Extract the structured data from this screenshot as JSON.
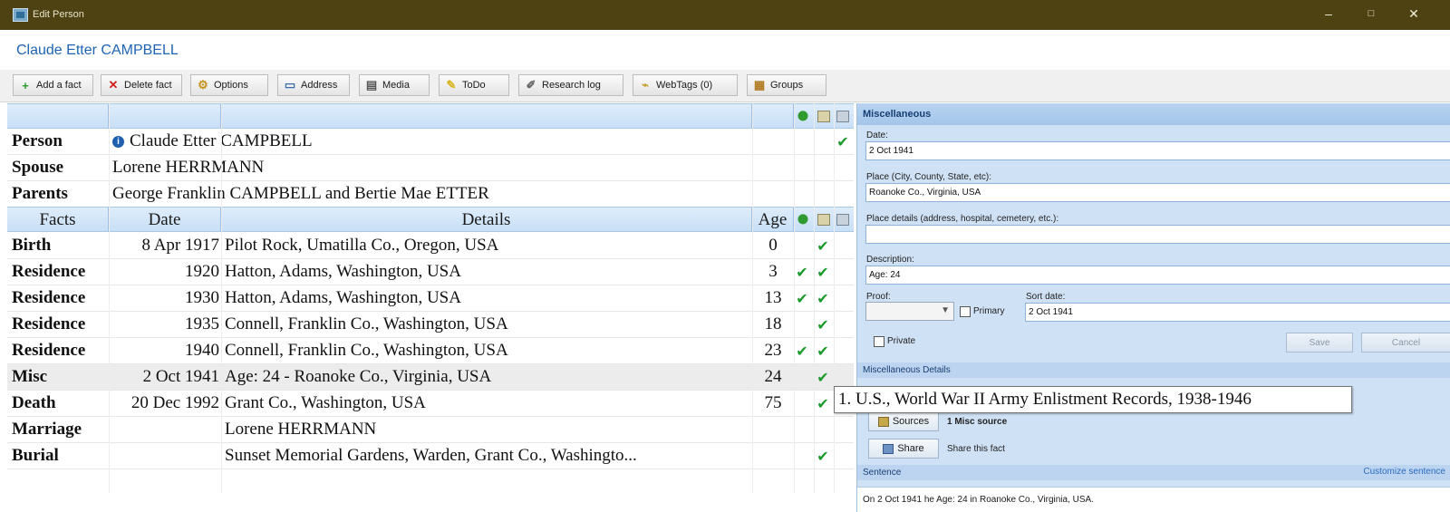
{
  "window": {
    "title": "Edit Person",
    "minimize": "–",
    "maximize": "□",
    "close": "✕"
  },
  "header": {
    "person_name": "Claude Etter CAMPBELL"
  },
  "toolbar": {
    "add_fact": "Add a fact",
    "delete_fact": "Delete fact",
    "options": "Options",
    "address": "Address",
    "media": "Media",
    "todo": "ToDo",
    "research_log": "Research log",
    "webtags": "WebTags (0)",
    "groups": "Groups"
  },
  "summary": [
    {
      "label": "Person",
      "value": "Claude Etter CAMPBELL",
      "check": "✔"
    },
    {
      "label": "Spouse",
      "value": "Lorene HERRMANN",
      "check": ""
    },
    {
      "label": "Parents",
      "value": "George Franklin CAMPBELL and Bertie Mae ETTER",
      "check": ""
    }
  ],
  "columns": {
    "facts": "Facts",
    "date": "Date",
    "details": "Details",
    "age": "Age"
  },
  "facts": [
    {
      "fact": "Birth",
      "date": "8 Apr 1917",
      "details": "Pilot Rock, Umatilla Co., Oregon, USA",
      "age": "0",
      "tree": "",
      "source": "✔"
    },
    {
      "fact": "Residence",
      "date": "1920",
      "details": "Hatton, Adams, Washington, USA",
      "age": "3",
      "tree": "✔",
      "source": "✔"
    },
    {
      "fact": "Residence",
      "date": "1930",
      "details": "Hatton, Adams, Washington, USA",
      "age": "13",
      "tree": "✔",
      "source": "✔"
    },
    {
      "fact": "Residence",
      "date": "1935",
      "details": "Connell, Franklin Co., Washington, USA",
      "age": "18",
      "tree": "",
      "source": "✔"
    },
    {
      "fact": "Residence",
      "date": "1940",
      "details": "Connell, Franklin Co., Washington, USA",
      "age": "23",
      "tree": "✔",
      "source": "✔"
    },
    {
      "fact": "Misc",
      "date": "2 Oct 1941",
      "details": "Age: 24 - Roanoke Co., Virginia, USA",
      "age": "24",
      "tree": "",
      "source": "✔"
    },
    {
      "fact": "Death",
      "date": "20 Dec 1992",
      "details": "Grant Co., Washington, USA",
      "age": "75",
      "tree": "",
      "source": "✔"
    },
    {
      "fact": "Marriage",
      "date": "",
      "details": "Lorene HERRMANN",
      "age": "",
      "tree": "",
      "source": ""
    },
    {
      "fact": "Burial",
      "date": "",
      "details": "Sunset Memorial Gardens, Warden, Grant Co., Washingto...",
      "age": "",
      "tree": "",
      "source": "✔"
    }
  ],
  "tooltip": "1. U.S., World War II Army Enlistment Records, 1938-1946",
  "panel": {
    "title": "Miscellaneous",
    "date_label": "Date:",
    "date_value": "2 Oct 1941",
    "place_label": "Place (City, County, State, etc):",
    "place_value": "Roanoke Co., Virginia, USA",
    "place_details_label": "Place details (address, hospital, cemetery, etc.):",
    "place_details_value": "",
    "description_label": "Description:",
    "description_value": "Age: 24",
    "proof_label": "Proof:",
    "primary_label": "Primary",
    "sort_date_label": "Sort date:",
    "sort_date_value": "2 Oct 1941",
    "private_label": "Private",
    "save_label": "Save",
    "cancel_label": "Cancel",
    "details_section": "Miscellaneous Details",
    "sources_button": "Sources",
    "sources_text": "1 Misc source",
    "share_button": "Share",
    "share_text": "Share this fact",
    "sentence_section": "Sentence",
    "customize_link": "Customize sentence",
    "sentence_text": "On 2 Oct 1941 he Age: 24 in Roanoke Co., Virginia, USA."
  }
}
